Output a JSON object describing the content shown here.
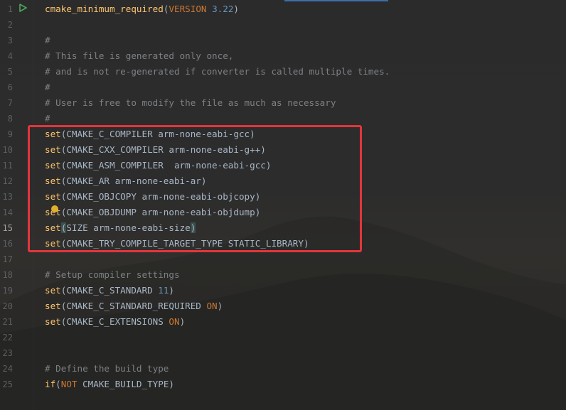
{
  "colors": {
    "function": "#ffc66d",
    "comment": "#7d8084",
    "keyword": "#cc7832",
    "number": "#6897bb",
    "text": "#a9b7c6",
    "highlight_border": "#e3353b",
    "line_number": "#5c5f63"
  },
  "editor": {
    "run_icon": "run-arrow-icon",
    "current_line": 15,
    "lines": [
      {
        "n": "1",
        "segments": [
          {
            "t": "cmake_minimum_required",
            "c": "t-fn"
          },
          {
            "t": "(",
            "c": "t-paren"
          },
          {
            "t": "VERSION",
            "c": "t-kw"
          },
          {
            "t": " ",
            "c": "t-id"
          },
          {
            "t": "3.22",
            "c": "t-num"
          },
          {
            "t": ")",
            "c": "t-paren"
          }
        ]
      },
      {
        "n": "2",
        "segments": []
      },
      {
        "n": "3",
        "segments": [
          {
            "t": "#",
            "c": "t-cm"
          }
        ]
      },
      {
        "n": "4",
        "segments": [
          {
            "t": "# This file is generated only once,",
            "c": "t-cm"
          }
        ]
      },
      {
        "n": "5",
        "segments": [
          {
            "t": "# and is not re-generated if converter is called multiple times.",
            "c": "t-cm"
          }
        ]
      },
      {
        "n": "6",
        "segments": [
          {
            "t": "#",
            "c": "t-cm"
          }
        ]
      },
      {
        "n": "7",
        "segments": [
          {
            "t": "# User is free to modify the file as much as necessary",
            "c": "t-cm"
          }
        ]
      },
      {
        "n": "8",
        "segments": [
          {
            "t": "#",
            "c": "t-cm"
          }
        ]
      },
      {
        "n": "9",
        "segments": [
          {
            "t": "set",
            "c": "t-fn"
          },
          {
            "t": "(CMAKE_C_COMPILER arm-none-eabi-gcc)",
            "c": "t-id"
          }
        ]
      },
      {
        "n": "10",
        "segments": [
          {
            "t": "set",
            "c": "t-fn"
          },
          {
            "t": "(CMAKE_CXX_COMPILER arm-none-eabi-g++)",
            "c": "t-id"
          }
        ]
      },
      {
        "n": "11",
        "segments": [
          {
            "t": "set",
            "c": "t-fn"
          },
          {
            "t": "(CMAKE_ASM_COMPILER  arm-none-eabi-gcc)",
            "c": "t-id"
          }
        ]
      },
      {
        "n": "12",
        "segments": [
          {
            "t": "set",
            "c": "t-fn"
          },
          {
            "t": "(CMAKE_AR arm-none-eabi-ar)",
            "c": "t-id"
          }
        ]
      },
      {
        "n": "13",
        "segments": [
          {
            "t": "set",
            "c": "t-fn"
          },
          {
            "t": "(CMAKE_OBJCOPY arm-none-eabi-objcopy)",
            "c": "t-id"
          }
        ]
      },
      {
        "n": "14",
        "segments": [
          {
            "t": "set",
            "c": "t-fn"
          },
          {
            "t": "(CMAKE_OBJDUMP arm-none-eabi-objdump)",
            "c": "t-id"
          }
        ]
      },
      {
        "n": "15",
        "segments": [
          {
            "t": "set",
            "c": "t-fn"
          },
          {
            "t": "(",
            "c": "t-paren-hl"
          },
          {
            "t": "SIZE arm-none-eabi-size",
            "c": "t-id"
          },
          {
            "t": ")",
            "c": "t-paren-hl"
          }
        ]
      },
      {
        "n": "16",
        "segments": [
          {
            "t": "set",
            "c": "t-fn"
          },
          {
            "t": "(CMAKE_TRY_COMPILE_TARGET_TYPE STATIC_LIBRARY)",
            "c": "t-id"
          }
        ]
      },
      {
        "n": "17",
        "segments": []
      },
      {
        "n": "18",
        "segments": [
          {
            "t": "# Setup compiler settings",
            "c": "t-cm"
          }
        ]
      },
      {
        "n": "19",
        "segments": [
          {
            "t": "set",
            "c": "t-fn"
          },
          {
            "t": "(CMAKE_C_STANDARD ",
            "c": "t-id"
          },
          {
            "t": "11",
            "c": "t-num"
          },
          {
            "t": ")",
            "c": "t-id"
          }
        ]
      },
      {
        "n": "20",
        "segments": [
          {
            "t": "set",
            "c": "t-fn"
          },
          {
            "t": "(CMAKE_C_STANDARD_REQUIRED ",
            "c": "t-id"
          },
          {
            "t": "ON",
            "c": "t-kw"
          },
          {
            "t": ")",
            "c": "t-id"
          }
        ]
      },
      {
        "n": "21",
        "segments": [
          {
            "t": "set",
            "c": "t-fn"
          },
          {
            "t": "(CMAKE_C_EXTENSIONS ",
            "c": "t-id"
          },
          {
            "t": "ON",
            "c": "t-kw"
          },
          {
            "t": ")",
            "c": "t-id"
          }
        ]
      },
      {
        "n": "22",
        "segments": []
      },
      {
        "n": "23",
        "segments": []
      },
      {
        "n": "24",
        "segments": [
          {
            "t": "# Define the build type",
            "c": "t-cm"
          }
        ]
      },
      {
        "n": "25",
        "segments": [
          {
            "t": "if",
            "c": "t-fn"
          },
          {
            "t": "(",
            "c": "t-id"
          },
          {
            "t": "NOT",
            "c": "t-kw"
          },
          {
            "t": " CMAKE_BUILD_TYPE)",
            "c": "t-id"
          }
        ]
      }
    ]
  }
}
